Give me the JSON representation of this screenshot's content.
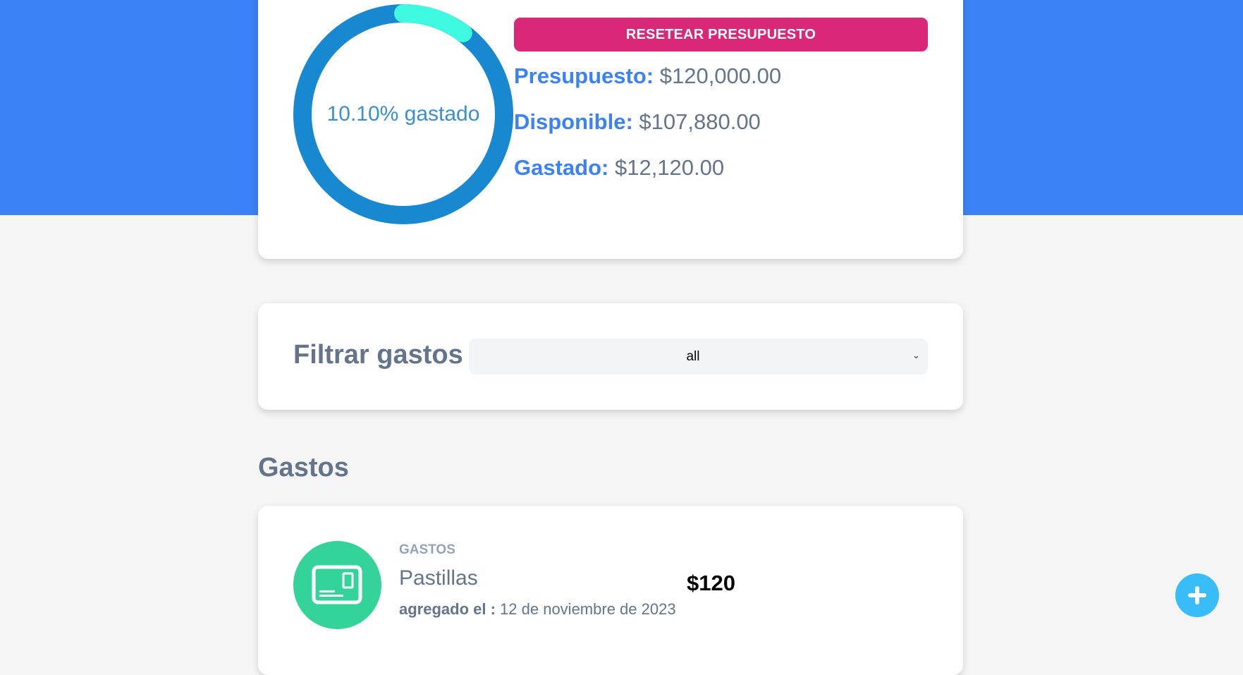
{
  "budget": {
    "progress_percent": 10.1,
    "progress_label": "10.10% gastado",
    "reset_button": "RESETEAR PRESUPUESTO",
    "budget_label": "Presupuesto:",
    "budget_value": "$120,000.00",
    "available_label": "Disponible:",
    "available_value": "$107,880.00",
    "spent_label": "Gastado:",
    "spent_value": "$12,120.00",
    "colors": {
      "track": "#1889d0",
      "progress": "#3ef8e0",
      "reset_button": "#db2777",
      "header": "#3b82f6"
    }
  },
  "filter": {
    "label": "Filtrar gastos",
    "selected": "all"
  },
  "expenses": {
    "title": "Gastos",
    "items": [
      {
        "category": "GASTOS",
        "name": "Pastillas",
        "date_label": "agregado el :",
        "date": "12 de noviembre de 2023",
        "amount": "$120",
        "icon": "expense-card-icon"
      }
    ]
  },
  "fab": {
    "icon": "plus-icon"
  }
}
